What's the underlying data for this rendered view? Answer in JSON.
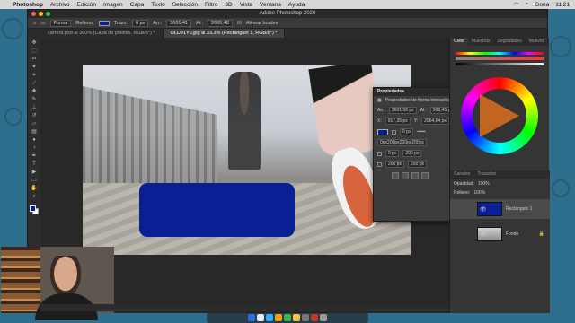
{
  "menubar": {
    "app": "Photoshop",
    "items": [
      "Archivo",
      "Edición",
      "Imagen",
      "Capa",
      "Texto",
      "Selección",
      "Filtro",
      "3D",
      "Vista",
      "Ventana",
      "Ayuda"
    ],
    "user": "Goria",
    "clock": "11:21"
  },
  "window": {
    "title": "Adobe Photoshop 2020"
  },
  "options": {
    "shape_mode": "Forma",
    "fill_label": "Relleno:",
    "stroke_label": "Trazo:",
    "stroke_width": "0 px",
    "w_label": "An.:",
    "w_value": "3601,41",
    "h_label": "Al.:",
    "h_value": "2665,48",
    "align_edges": "Alinear bordes"
  },
  "tabs": [
    {
      "label": "carrera.psd al 300% (Capa de píxeles, RGB/8*) *"
    },
    {
      "label": "OLD91Y0.jpg al 33,3% (Rectángulo 1, RGB/8*) *"
    }
  ],
  "properties": {
    "title": "Propiedades",
    "section": "Propiedades de forma interactiva",
    "an_label": "An.:",
    "an_value": "3601,36 px",
    "al_label": "Al.:",
    "al_value": "906,45 px",
    "x_label": "X:",
    "x_value": "917,35 px",
    "y_label": "Y:",
    "y_value": "2064,64 px",
    "stroke_value": "0 px",
    "radius_combined": "0px200px200px200px",
    "r1": "0 px",
    "r2": "200 px",
    "r3": "200 px",
    "r4": "200 px"
  },
  "colors_panel": {
    "tabs": [
      "Color",
      "Muestras",
      "Degradados",
      "Motivos"
    ]
  },
  "layers_panel": {
    "tabs": [
      "Canales",
      "Trazados"
    ],
    "opacity_label": "Opacidad:",
    "opacity_value": "100%",
    "fill_label": "Relleno:",
    "fill_value": "100%",
    "layers": [
      {
        "name": "Rectángulo 1",
        "selected": true
      },
      {
        "name": "Fondo",
        "selected": false
      }
    ]
  },
  "accent": {
    "shape_color": "#0a1f94"
  }
}
